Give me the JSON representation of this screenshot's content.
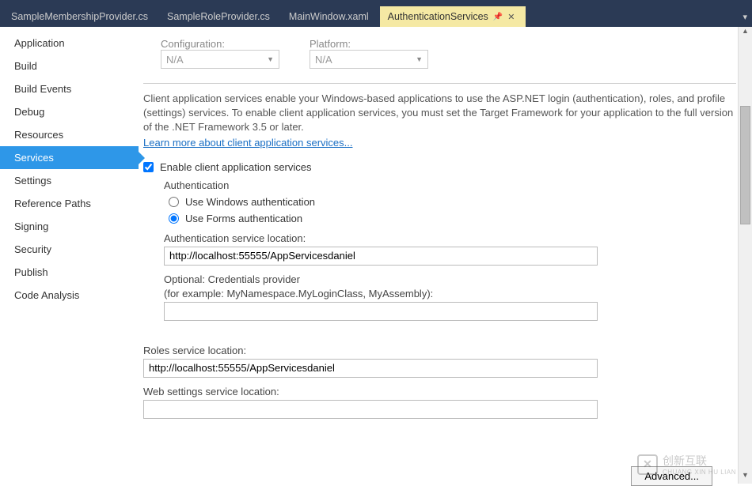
{
  "tabs": {
    "items": [
      {
        "label": "SampleMembershipProvider.cs"
      },
      {
        "label": "SampleRoleProvider.cs"
      },
      {
        "label": "MainWindow.xaml"
      },
      {
        "label": "AuthenticationServices"
      }
    ],
    "active_index": 3
  },
  "sidebar": {
    "items": [
      {
        "label": "Application"
      },
      {
        "label": "Build"
      },
      {
        "label": "Build Events"
      },
      {
        "label": "Debug"
      },
      {
        "label": "Resources"
      },
      {
        "label": "Services"
      },
      {
        "label": "Settings"
      },
      {
        "label": "Reference Paths"
      },
      {
        "label": "Signing"
      },
      {
        "label": "Security"
      },
      {
        "label": "Publish"
      },
      {
        "label": "Code Analysis"
      }
    ],
    "active_index": 5
  },
  "toprow": {
    "config_label": "Configuration:",
    "config_value": "N/A",
    "platform_label": "Platform:",
    "platform_value": "N/A"
  },
  "description": "Client application services enable your Windows-based applications to use the ASP.NET login (authentication), roles, and profile (settings) services. To enable client application services, you must set the Target Framework for your application to the full version of the .NET Framework 3.5 or later.",
  "learn_more": "Learn more about client application services...",
  "enable_checkbox": {
    "label": "Enable client application services",
    "checked": true
  },
  "auth_group": {
    "title": "Authentication",
    "windows_label": "Use Windows authentication",
    "forms_label": "Use Forms authentication",
    "selected": "forms",
    "service_loc_label": "Authentication service location:",
    "service_loc_value": "http://localhost:55555/AppServicesdaniel",
    "cred_label1": "Optional: Credentials provider",
    "cred_label2": "(for example: MyNamespace.MyLoginClass, MyAssembly):",
    "cred_value": ""
  },
  "roles": {
    "label": "Roles service location:",
    "value": "http://localhost:55555/AppServicesdaniel"
  },
  "websettings": {
    "label": "Web settings service location:",
    "value": ""
  },
  "advanced_btn": "Advanced...",
  "watermark": {
    "brand": "创新互联",
    "sub": "CHUANG XIN HU LIAN"
  }
}
